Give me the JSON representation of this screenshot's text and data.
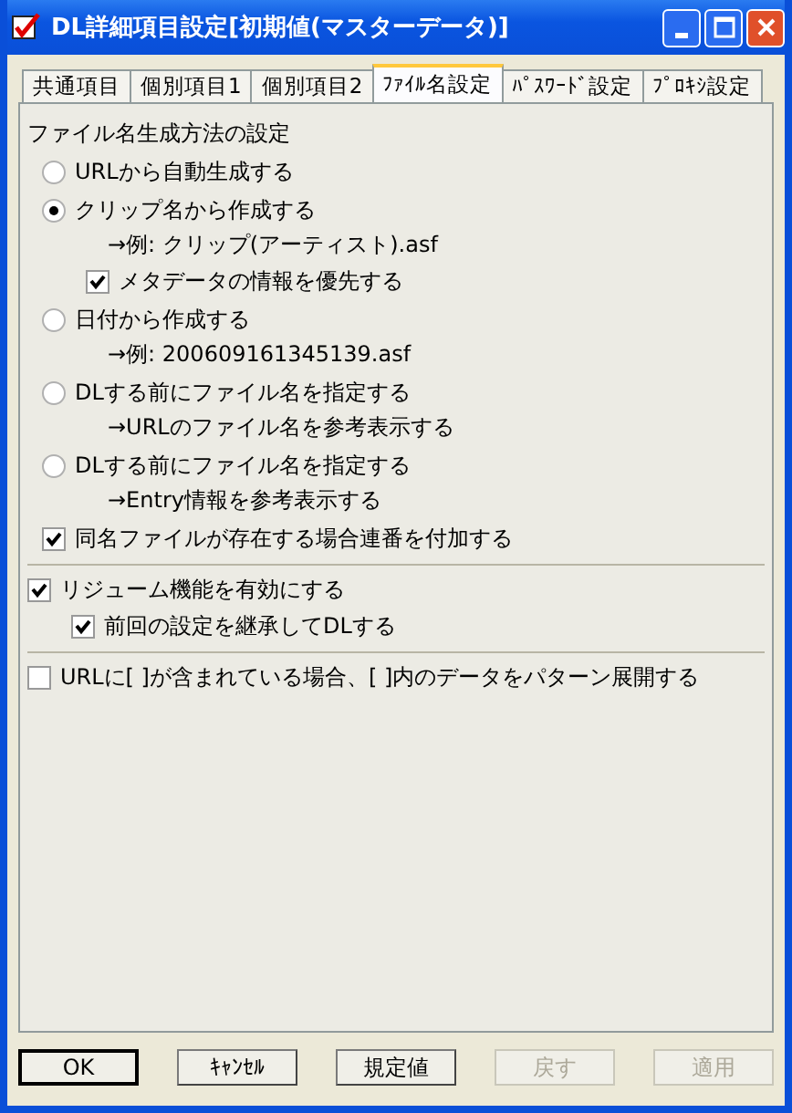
{
  "window": {
    "title": "DL詳細項目設定[初期値(マスターデータ)]"
  },
  "tabs": [
    {
      "label": "共通項目",
      "selected": false
    },
    {
      "label": "個別項目1",
      "selected": false
    },
    {
      "label": "個別項目2",
      "selected": false
    },
    {
      "label": "ﾌｧｲﾙ名設定",
      "selected": true
    },
    {
      "label": "ﾊﾟｽﾜｰﾄﾞ設定",
      "selected": false
    },
    {
      "label": "ﾌﾟﾛｷｼ設定",
      "selected": false
    }
  ],
  "sections": [
    {
      "heading": "ファイル名生成方法の設定",
      "items": [
        {
          "kind": "radio",
          "label": "URLから自動生成する",
          "selected": false
        },
        {
          "kind": "radio",
          "label": "クリップ名から作成する",
          "selected": true,
          "children": [
            {
              "kind": "note",
              "text": "→例: クリップ(アーティスト).asf"
            },
            {
              "kind": "checkbox",
              "label": "メタデータの情報を優先する",
              "checked": true
            }
          ]
        },
        {
          "kind": "radio",
          "label": "日付から作成する",
          "selected": false,
          "children": [
            {
              "kind": "note",
              "text": "→例: 200609161345139.asf"
            }
          ]
        },
        {
          "kind": "radio",
          "label": "DLする前にファイル名を指定する",
          "selected": false,
          "children": [
            {
              "kind": "note",
              "text": "→URLのファイル名を参考表示する"
            }
          ]
        },
        {
          "kind": "radio",
          "label": "DLする前にファイル名を指定する",
          "selected": false,
          "children": [
            {
              "kind": "note",
              "text": "→Entry情報を参考表示する"
            }
          ]
        },
        {
          "kind": "checkbox",
          "label": "同名ファイルが存在する場合連番を付加する",
          "checked": true
        }
      ]
    },
    {
      "items": [
        {
          "kind": "checkbox",
          "label": "リジューム機能を有効にする",
          "checked": true,
          "children": [
            {
              "kind": "checkbox",
              "label": "前回の設定を継承してDLする",
              "checked": true
            }
          ]
        }
      ]
    },
    {
      "items": [
        {
          "kind": "checkbox",
          "label": "URLに[ ]が含まれている場合、[ ]内のデータをパターン展開する",
          "checked": false
        }
      ]
    }
  ],
  "buttons": [
    {
      "label": "OK",
      "default": true,
      "disabled": false
    },
    {
      "label": "ｷｬﾝｾﾙ",
      "default": false,
      "disabled": false
    },
    {
      "label": "規定値",
      "default": false,
      "disabled": false
    },
    {
      "label": "戻す",
      "default": false,
      "disabled": true
    },
    {
      "label": "適用",
      "default": false,
      "disabled": true
    }
  ]
}
